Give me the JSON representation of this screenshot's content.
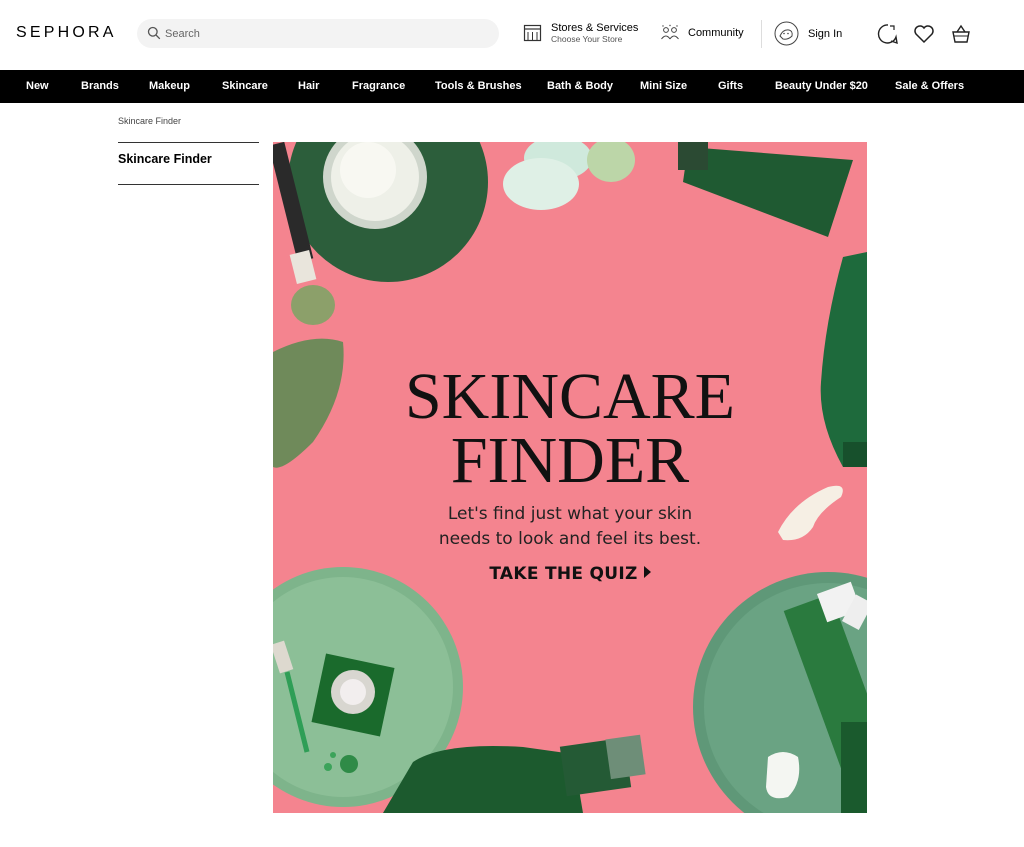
{
  "brand": {
    "logo_text": "SEPHORA"
  },
  "search": {
    "placeholder": "Search",
    "icon": "search-icon"
  },
  "header": {
    "stores_title": "Stores & Services",
    "stores_sub": "Choose Your Store",
    "community": "Community",
    "sign_in": "Sign In",
    "icons": [
      "store-icon",
      "community-icon",
      "avatar-icon",
      "chat-icon",
      "heart-icon",
      "basket-icon"
    ]
  },
  "nav": {
    "items": [
      "New",
      "Brands",
      "Makeup",
      "Skincare",
      "Hair",
      "Fragrance",
      "Tools & Brushes",
      "Bath & Body",
      "Mini Size",
      "Gifts",
      "Beauty Under $20",
      "Sale & Offers"
    ]
  },
  "breadcrumb": "Skincare Finder",
  "sidebar": {
    "title": "Skincare Finder"
  },
  "hero": {
    "title_line1": "SKINCARE",
    "title_line2": "FINDER",
    "subtitle_line1": "Let's find just what your skin",
    "subtitle_line2": "needs to look and feel its best.",
    "cta": "TAKE THE QUIZ",
    "background_color": "#f4848f",
    "accent_green": "#2e6b3e"
  }
}
